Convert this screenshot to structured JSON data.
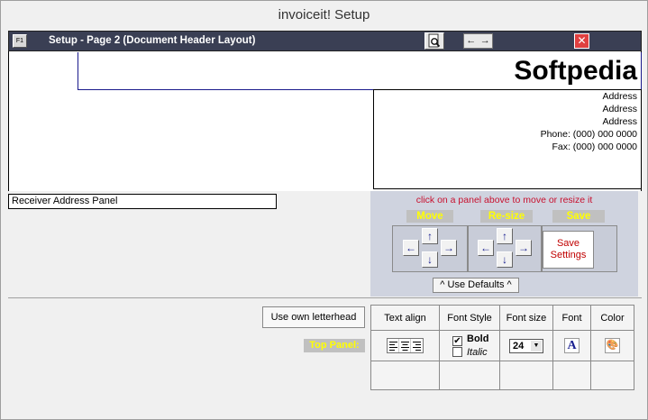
{
  "window": {
    "title": "invoiceit! Setup"
  },
  "toolbar": {
    "help_label": "F1",
    "title": "Setup - Page 2 (Document Header Layout)",
    "prev_arrow": "←",
    "next_arrow": "→",
    "close_glyph": "✕"
  },
  "header": {
    "company_name": "Softpedia",
    "address_lines": [
      "Address",
      "Address",
      "Address",
      "Phone: (000) 000 0000",
      "Fax: (000) 000 0000"
    ]
  },
  "receiver": {
    "label": "Receiver Address Panel"
  },
  "controls": {
    "hint": "click on a panel above to move or resize it",
    "move_label": "Move",
    "resize_label": "Re-size",
    "save_label": "Save",
    "save_button_line1": "Save",
    "save_button_line2": "Settings",
    "defaults_button": "^ Use Defaults ^",
    "arrows": {
      "up": "↑",
      "down": "↓",
      "left": "←",
      "right": "→"
    }
  },
  "options": {
    "letterhead_button": "Use own letterhead",
    "panel_label": "Top Panel:",
    "columns": [
      "Text align",
      "Font Style",
      "Font size",
      "Font",
      "Color"
    ],
    "bold_label": "Bold",
    "bold_checked": "✔",
    "italic_label": "Italic",
    "font_size": "24",
    "font_icon": "A",
    "color_icon": "🎨"
  }
}
